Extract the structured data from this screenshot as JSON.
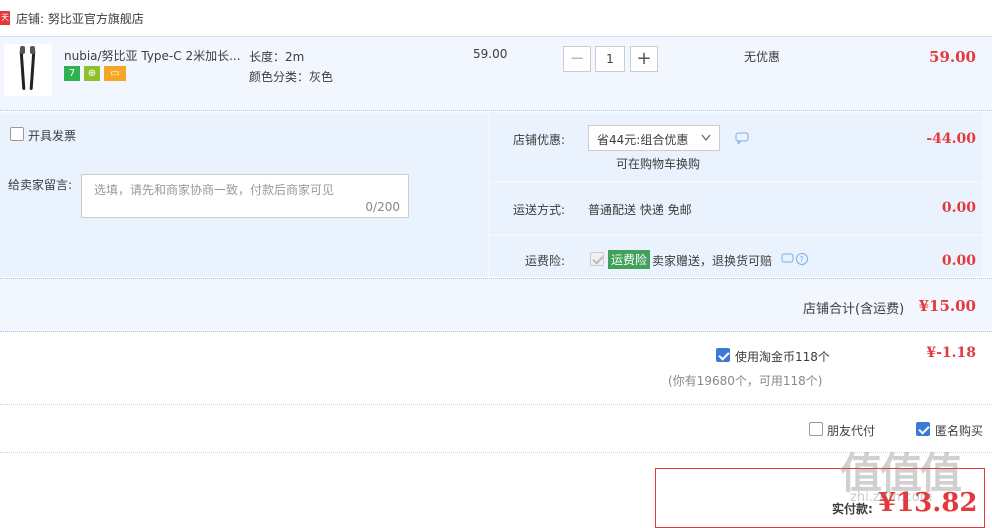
{
  "store": {
    "prefix": "店铺:",
    "name": "努比亚官方旗舰店",
    "badge": "天猫"
  },
  "item": {
    "title": "nubia/努比亚 Type-C 2米加长...",
    "attr_length": "长度：2m",
    "attr_color": "颜色分类：灰色",
    "unit_price": "59.00",
    "quantity": "1",
    "minus": "−",
    "plus": "+",
    "discount": "无优惠",
    "subtotal": "59.00",
    "badge7": "7"
  },
  "invoice": {
    "label": "开具发票"
  },
  "message": {
    "label": "给卖家留言:",
    "placeholder": "选填，请先和商家协商一致，付款后商家可见",
    "counter": "0/200"
  },
  "promo": {
    "label": "店铺优惠:",
    "value": "省44元:组合优惠",
    "hint": "可在购物车换购",
    "amount": "-44.00"
  },
  "shipping": {
    "label": "运送方式:",
    "value": "普通配送 快递 免邮",
    "amount": "0.00"
  },
  "insurance": {
    "label": "运费险:",
    "tag": "运费险",
    "desc": "卖家赠送，退换货可赔",
    "amount": "0.00"
  },
  "store_total": {
    "label": "店铺合计(含运费)",
    "amount": "¥15.00"
  },
  "coins": {
    "label": "使用淘金币118个",
    "amount": "¥-1.18",
    "note": "(你有19680个，可用118个)"
  },
  "options": {
    "friend_pay": "朋友代付",
    "anonymous": "匿名购买"
  },
  "pay": {
    "label": "实付款:",
    "amount": "¥13.82"
  },
  "watermark": {
    "brand": "值值值",
    "site": "zhi.zdm.com"
  },
  "colors": {
    "accent": "#e4393c",
    "check": "#3c78d8",
    "panel": "#f2f7ff"
  }
}
